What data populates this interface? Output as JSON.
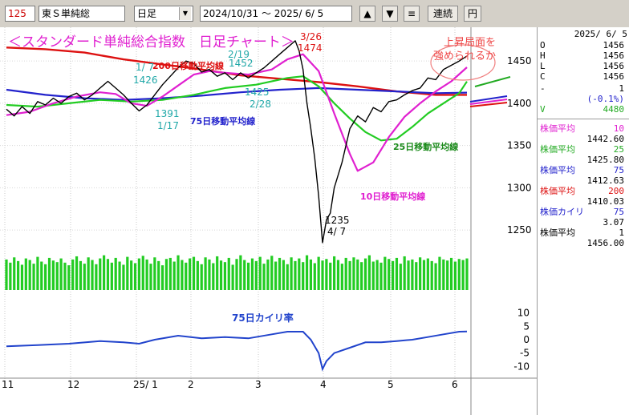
{
  "toolbar": {
    "code": "125",
    "name": "東Ｓ単純総",
    "period": "日足",
    "date_range": "2024/10/31 ～  2025/ 6/ 5",
    "up_icon": "triangle-up",
    "down_icon": "triangle-down",
    "menu_icon": "hamburger",
    "rensha_label": "連続",
    "yen_label": "円"
  },
  "chart_data": {
    "type": "line",
    "title": "＜スタンダード単純総合指数　日足チャート＞",
    "x_ticks": [
      "11",
      "12",
      "25/ 1",
      "2",
      "3",
      "4",
      "5",
      "6"
    ],
    "y_ticks": [
      "1450",
      "1400",
      "1350",
      "1300",
      "1250"
    ],
    "ylim": [
      1215,
      1490
    ],
    "lower_y_ticks": [
      "10",
      "5",
      "0",
      "-5",
      "-10"
    ],
    "lower_ylim": [
      -12,
      12
    ],
    "colors": {
      "price": "#000000",
      "ma10": "#e020d0",
      "ma25": "#22cc22",
      "ma75": "#2222cc",
      "ma200": "#dd1111",
      "volume": "#22cc22",
      "kairi": "#2244cc",
      "title": "#e020d0"
    },
    "series": [
      {
        "name": "",
        "key": "price",
        "values": [
          [
            0,
            1393
          ],
          [
            2,
            1385
          ],
          [
            4,
            1396
          ],
          [
            6,
            1388
          ],
          [
            8,
            1402
          ],
          [
            10,
            1398
          ],
          [
            12,
            1406
          ],
          [
            14,
            1400
          ],
          [
            16,
            1408
          ],
          [
            18,
            1412
          ],
          [
            20,
            1404
          ],
          [
            22,
            1410
          ],
          [
            24,
            1418
          ],
          [
            26,
            1426
          ],
          [
            28,
            1418
          ],
          [
            30,
            1410
          ],
          [
            32,
            1400
          ],
          [
            34,
            1391
          ],
          [
            36,
            1398
          ],
          [
            38,
            1410
          ],
          [
            40,
            1422
          ],
          [
            42,
            1432
          ],
          [
            44,
            1442
          ],
          [
            46,
            1450
          ],
          [
            48,
            1447
          ],
          [
            50,
            1437
          ],
          [
            52,
            1440
          ],
          [
            54,
            1432
          ],
          [
            56,
            1436
          ],
          [
            58,
            1428
          ],
          [
            60,
            1436
          ],
          [
            62,
            1430
          ],
          [
            64,
            1436
          ],
          [
            66,
            1442
          ],
          [
            68,
            1450
          ],
          [
            70,
            1458
          ],
          [
            72,
            1466
          ],
          [
            74,
            1474
          ],
          [
            75,
            1462
          ],
          [
            76,
            1440
          ],
          [
            77,
            1400
          ],
          [
            78,
            1370
          ],
          [
            79,
            1335
          ],
          [
            80,
            1290
          ],
          [
            81,
            1235
          ],
          [
            82,
            1262
          ],
          [
            83,
            1270
          ],
          [
            84,
            1300
          ],
          [
            86,
            1330
          ],
          [
            88,
            1370
          ],
          [
            90,
            1385
          ],
          [
            92,
            1378
          ],
          [
            94,
            1395
          ],
          [
            96,
            1390
          ],
          [
            98,
            1402
          ],
          [
            100,
            1404
          ],
          [
            102,
            1410
          ],
          [
            104,
            1415
          ],
          [
            106,
            1418
          ],
          [
            108,
            1430
          ],
          [
            110,
            1428
          ],
          [
            112,
            1440
          ],
          [
            114,
            1445
          ],
          [
            116,
            1450
          ],
          [
            118,
            1456
          ]
        ]
      },
      {
        "name": "200日移動平均線",
        "key": "ma200",
        "values": [
          [
            0,
            1466
          ],
          [
            10,
            1464
          ],
          [
            20,
            1460
          ],
          [
            30,
            1452
          ],
          [
            40,
            1446
          ],
          [
            50,
            1440
          ],
          [
            60,
            1433
          ],
          [
            70,
            1429
          ],
          [
            80,
            1425
          ],
          [
            90,
            1420
          ],
          [
            100,
            1414
          ],
          [
            110,
            1410
          ],
          [
            118,
            1410
          ]
        ]
      },
      {
        "name": "75日移動平均線",
        "key": "ma75",
        "values": [
          [
            0,
            1416
          ],
          [
            10,
            1410
          ],
          [
            20,
            1406
          ],
          [
            30,
            1404
          ],
          [
            40,
            1406
          ],
          [
            50,
            1409
          ],
          [
            60,
            1413
          ],
          [
            70,
            1416
          ],
          [
            80,
            1418
          ],
          [
            90,
            1416
          ],
          [
            100,
            1414
          ],
          [
            110,
            1412
          ],
          [
            118,
            1412.6
          ]
        ]
      },
      {
        "name": "25日移動平均線",
        "key": "ma25",
        "values": [
          [
            0,
            1398
          ],
          [
            8,
            1396
          ],
          [
            16,
            1400
          ],
          [
            24,
            1404
          ],
          [
            32,
            1402
          ],
          [
            40,
            1404
          ],
          [
            48,
            1410
          ],
          [
            56,
            1418
          ],
          [
            64,
            1422
          ],
          [
            72,
            1430
          ],
          [
            76,
            1432
          ],
          [
            80,
            1420
          ],
          [
            84,
            1400
          ],
          [
            88,
            1382
          ],
          [
            92,
            1366
          ],
          [
            96,
            1356
          ],
          [
            100,
            1358
          ],
          [
            104,
            1372
          ],
          [
            108,
            1388
          ],
          [
            112,
            1400
          ],
          [
            116,
            1412
          ],
          [
            118,
            1425.8
          ]
        ]
      },
      {
        "name": "10日移動平均線",
        "key": "ma10",
        "values": [
          [
            0,
            1386
          ],
          [
            6,
            1390
          ],
          [
            12,
            1400
          ],
          [
            18,
            1408
          ],
          [
            24,
            1413
          ],
          [
            28,
            1411
          ],
          [
            32,
            1400
          ],
          [
            36,
            1397
          ],
          [
            40,
            1408
          ],
          [
            44,
            1421
          ],
          [
            48,
            1434
          ],
          [
            52,
            1438
          ],
          [
            56,
            1436
          ],
          [
            62,
            1434
          ],
          [
            68,
            1440
          ],
          [
            72,
            1452
          ],
          [
            76,
            1458
          ],
          [
            80,
            1438
          ],
          [
            84,
            1388
          ],
          [
            88,
            1340
          ],
          [
            90,
            1320
          ],
          [
            94,
            1330
          ],
          [
            98,
            1360
          ],
          [
            102,
            1384
          ],
          [
            106,
            1400
          ],
          [
            110,
            1414
          ],
          [
            114,
            1426
          ],
          [
            118,
            1442.6
          ]
        ]
      }
    ],
    "volume": [
      58,
      52,
      62,
      55,
      48,
      60,
      57,
      50,
      63,
      54,
      49,
      61,
      56,
      53,
      60,
      52,
      47,
      58,
      64,
      55,
      50,
      62,
      57,
      49,
      60,
      66,
      59,
      52,
      61,
      54,
      48,
      63,
      56,
      51,
      60,
      65,
      58,
      50,
      62,
      55,
      47,
      59,
      61,
      54,
      66,
      57,
      52,
      60,
      63,
      55,
      49,
      62,
      58,
      51,
      64,
      56,
      53,
      61,
      48,
      59,
      66,
      57,
      52,
      60,
      55,
      63,
      50,
      58,
      65,
      54,
      61,
      57,
      49,
      62,
      55,
      60,
      53,
      66,
      58,
      51,
      63,
      56,
      59,
      52,
      64,
      57,
      50,
      61,
      55,
      62,
      58,
      53,
      60,
      66,
      54,
      57,
      52,
      63,
      59,
      55,
      61,
      50,
      64,
      56,
      58,
      53,
      62,
      57,
      60,
      55,
      51,
      63,
      58,
      56,
      61,
      54,
      59,
      57,
      60
    ],
    "kairi": [
      [
        0,
        -2.5
      ],
      [
        8,
        -2
      ],
      [
        16,
        -1.5
      ],
      [
        24,
        -0.5
      ],
      [
        30,
        -1
      ],
      [
        34,
        -1.5
      ],
      [
        38,
        0
      ],
      [
        44,
        1.5
      ],
      [
        50,
        0.5
      ],
      [
        56,
        1
      ],
      [
        62,
        0.5
      ],
      [
        68,
        2
      ],
      [
        72,
        3
      ],
      [
        76,
        3
      ],
      [
        78,
        0
      ],
      [
        80,
        -5
      ],
      [
        81,
        -11
      ],
      [
        82,
        -8
      ],
      [
        84,
        -5
      ],
      [
        88,
        -3
      ],
      [
        92,
        -1
      ],
      [
        96,
        -1
      ],
      [
        100,
        -0.5
      ],
      [
        104,
        0
      ],
      [
        108,
        1
      ],
      [
        112,
        2
      ],
      [
        116,
        3
      ],
      [
        118,
        3.07
      ]
    ],
    "annotations": {
      "ma200_label": "200日移動平均線",
      "ma75_label": "75日移動平均線",
      "ma25_label": "25日移動平均線",
      "ma10_label": "10日移動平均線",
      "kairi_label": "75日カイリ率",
      "note_line1": "上昇局面を",
      "note_line2": "強められるか",
      "high_mar_date": "3/26",
      "high_mar_val": "1474",
      "low_apr_val": "1235",
      "low_apr_date": "4/ 7",
      "jan_high_date": "1/ 7",
      "jan_high_val": "1426",
      "jan_low_val": "1391",
      "jan_low_date": "1/17",
      "feb_high_date": "2/19",
      "feb_high_val": "1452",
      "feb_low_val": "1425",
      "feb_low_date": "2/28"
    }
  },
  "panel": {
    "date": "2025/ 6/ 5",
    "ohlc": [
      {
        "label": "O",
        "value": "1456"
      },
      {
        "label": "H",
        "value": "1456"
      },
      {
        "label": "L",
        "value": "1456"
      },
      {
        "label": "C",
        "value": "1456"
      }
    ],
    "change_label": "-",
    "change_value": "1",
    "change_pct": "(-0.1%)",
    "volume_label": "V",
    "volume_value": "4480",
    "indicators": [
      {
        "label": "株価平均",
        "param": "10",
        "value": "1442.60",
        "color": "#e020d0"
      },
      {
        "label": "株価平均",
        "param": "25",
        "value": "1425.80",
        "color": "#22aa22"
      },
      {
        "label": "株価平均",
        "param": "75",
        "value": "1412.63",
        "color": "#2222cc"
      },
      {
        "label": "株価平均",
        "param": "200",
        "value": "1410.03",
        "color": "#dd1111"
      },
      {
        "label": "株価カイリ",
        "param": "75",
        "value": "3.07",
        "color": "#2222cc"
      },
      {
        "label": "株価平均",
        "param": "1",
        "value": "1456.00",
        "color": "#000000"
      }
    ]
  }
}
